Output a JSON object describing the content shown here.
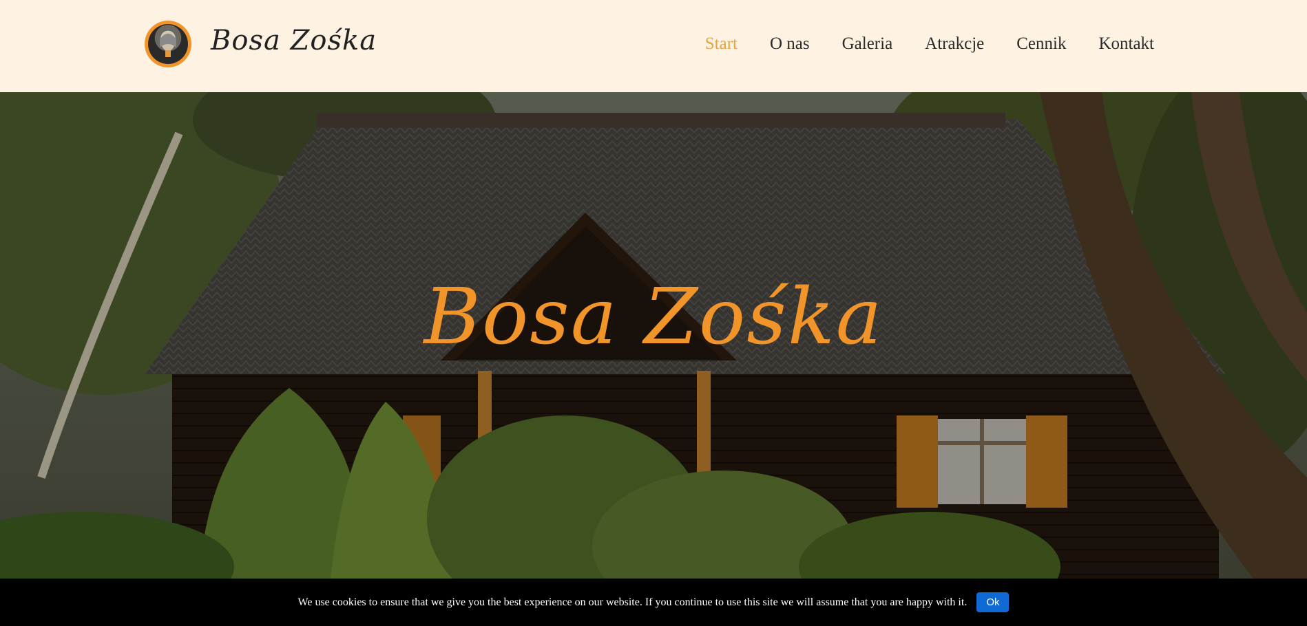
{
  "header": {
    "brand": "Bosa Zośka",
    "nav": [
      {
        "label": "Start",
        "active": true
      },
      {
        "label": "O nas",
        "active": false
      },
      {
        "label": "Galeria",
        "active": false
      },
      {
        "label": "Atrakcje",
        "active": false
      },
      {
        "label": "Cennik",
        "active": false
      },
      {
        "label": "Kontakt",
        "active": false
      }
    ]
  },
  "hero": {
    "title": "Bosa Zośka"
  },
  "cookie": {
    "text": "We use cookies to ensure that we give you the best experience on our website. If you continue to use this site we will assume that you are happy with it.",
    "button": "Ok"
  },
  "colors": {
    "header_bg": "#fef3e2",
    "accent": "#f1942a",
    "nav_active": "#e5a441",
    "cookie_bg": "#000000",
    "cookie_button": "#0f6ad6"
  }
}
